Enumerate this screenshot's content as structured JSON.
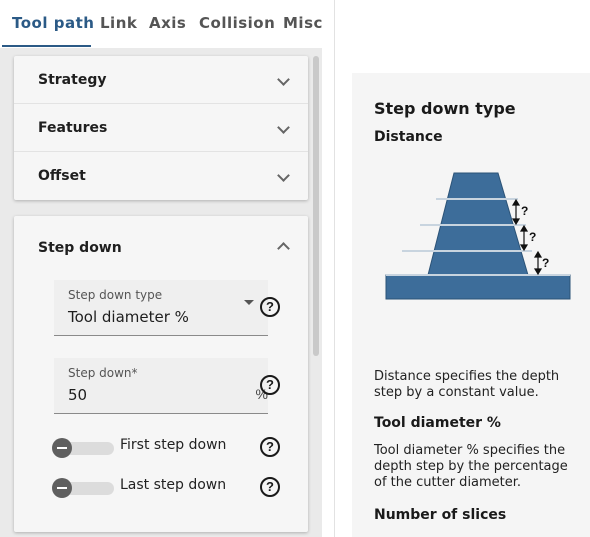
{
  "tabs": [
    {
      "label": "Tool path",
      "active": true
    },
    {
      "label": "Link",
      "active": false
    },
    {
      "label": "Axis",
      "active": false
    },
    {
      "label": "Collision",
      "active": false
    },
    {
      "label": "Misc",
      "active": false
    }
  ],
  "sections": {
    "strategy": "Strategy",
    "features": "Features",
    "offset": "Offset",
    "step_down": "Step down"
  },
  "step_down_type": {
    "label": "Step down type",
    "value": "Tool diameter %"
  },
  "step_down": {
    "label": "Step down*",
    "value": "50",
    "unit": "%"
  },
  "toggles": {
    "first_step_down": {
      "label": "First step down",
      "on": false
    },
    "last_step_down": {
      "label": "Last step down",
      "on": false
    }
  },
  "help_icon_text": "?",
  "help_panel": {
    "title": "Step down type",
    "subtitle_distance": "Distance",
    "diagram_marks": [
      "?",
      "?",
      "?"
    ],
    "distance_text": "Distance specifies the depth step by a constant value.",
    "tool_diameter_title": "Tool diameter %",
    "tool_diameter_text": "Tool diameter % specifies the depth step by the percentage of the cutter diameter.",
    "slices_title": "Number of slices"
  },
  "colors": {
    "accent": "#2b5a86",
    "diagram_fill": "#3d6d9a",
    "diagram_stroke": "#2c5377"
  }
}
